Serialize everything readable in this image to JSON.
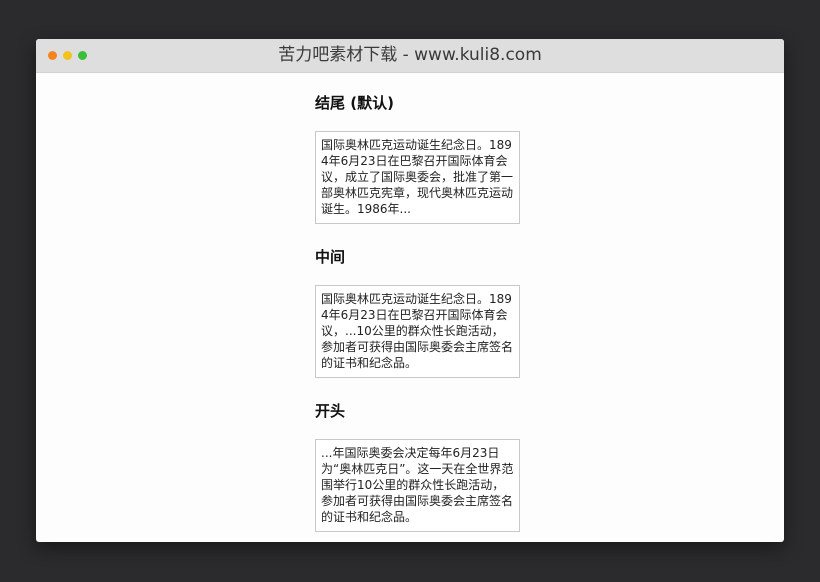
{
  "window": {
    "title": "苦力吧素材下载 - www.kuli8.com"
  },
  "sections": [
    {
      "heading": "结尾 (默认)",
      "text": "国际奥林匹克运动诞生纪念日。1894年6月23日在巴黎召开国际体育会议，成立了国际奥委会，批准了第一部奥林匹克宪章，现代奥林匹克运动诞生。1986年..."
    },
    {
      "heading": "中间",
      "text": "国际奥林匹克运动诞生纪念日。1894年6月23日在巴黎召开国际体育会议，...10公里的群众性长跑活动，参加者可获得由国际奥委会主席签名的证书和纪念品。"
    },
    {
      "heading": "开头",
      "text": "...年国际奥委会决定每年6月23日为“奥林匹克日”。这一天在全世界范围举行10公里的群众性长跑活动，参加者可获得由国际奥委会主席签名的证书和纪念品。"
    }
  ]
}
